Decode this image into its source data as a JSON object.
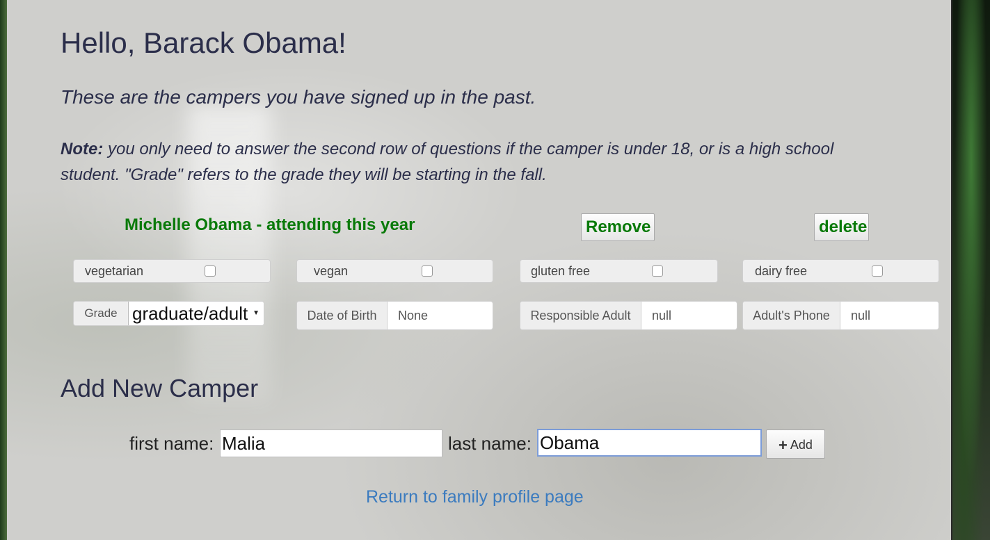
{
  "greeting": "Hello, Barack Obama!",
  "intro": "These are the campers you have signed up in the past.",
  "note": {
    "label": "Note:",
    "text": " you only need to answer the second row of questions if the camper is under 18, or is a high school student. \"Grade\" refers to the grade they will be starting in the fall."
  },
  "camper": {
    "name_status": "Michelle Obama - attending this year",
    "remove_label": "Remove",
    "delete_label": "delete",
    "diet": [
      {
        "label": "vegetarian",
        "checked": false
      },
      {
        "label": "vegan",
        "checked": false
      },
      {
        "label": "gluten free",
        "checked": false
      },
      {
        "label": "dairy free",
        "checked": false
      }
    ],
    "grade_label": "Grade",
    "grade_value": "graduate/adult",
    "dob_label": "Date of Birth",
    "dob_value": "None",
    "adult_label": "Responsible Adult",
    "adult_value": "null",
    "phone_label": "Adult's Phone",
    "phone_value": "null"
  },
  "add_camper": {
    "heading": "Add New Camper",
    "first_label": "first name:",
    "first_value": "Malia",
    "last_label": "last name:",
    "last_value": "Obama",
    "add_label": "Add",
    "add_icon": "plus-icon"
  },
  "return_link": "Return to family profile page"
}
